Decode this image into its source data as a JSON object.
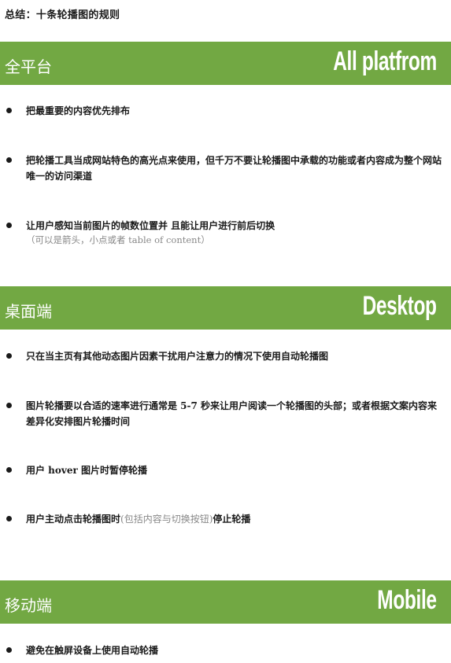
{
  "title": "总结：十条轮播图的规则",
  "sections": [
    {
      "cn": "全平台",
      "en": "All platfrom",
      "items": [
        "把最重要的内容优先排布",
        "把轮播工具当成网站特色的高光点来使用，但千万不要让轮播图中承载的功能或者内容成为整个网站唯一的访问渠道",
        "让用户感知当前图片的帧数位置并 且能让用户进行前后切换"
      ],
      "note": "（可以是箭头，小点或者 table of content）"
    },
    {
      "cn": "桌面端",
      "en": "Desktop",
      "items": [
        "只在当主页有其他动态图片因素干扰用户注意力的情况下使用自动轮播图",
        "图片轮播要以合适的速率进行通常是 5-7 秒来让用户阅读一个轮播图的头部；或者根据文案内容来差异化安排图片轮播时间",
        "用户 hover 图片时暂停轮播"
      ],
      "last_item": {
        "part1": "用户主动点击轮播图时",
        "part2": "(包括内容与切换按钮)",
        "part3": "停止轮播"
      }
    },
    {
      "cn": "移动端",
      "en": "Mobile",
      "items": [
        "避免在触屏设备上使用自动轮播"
      ]
    }
  ]
}
